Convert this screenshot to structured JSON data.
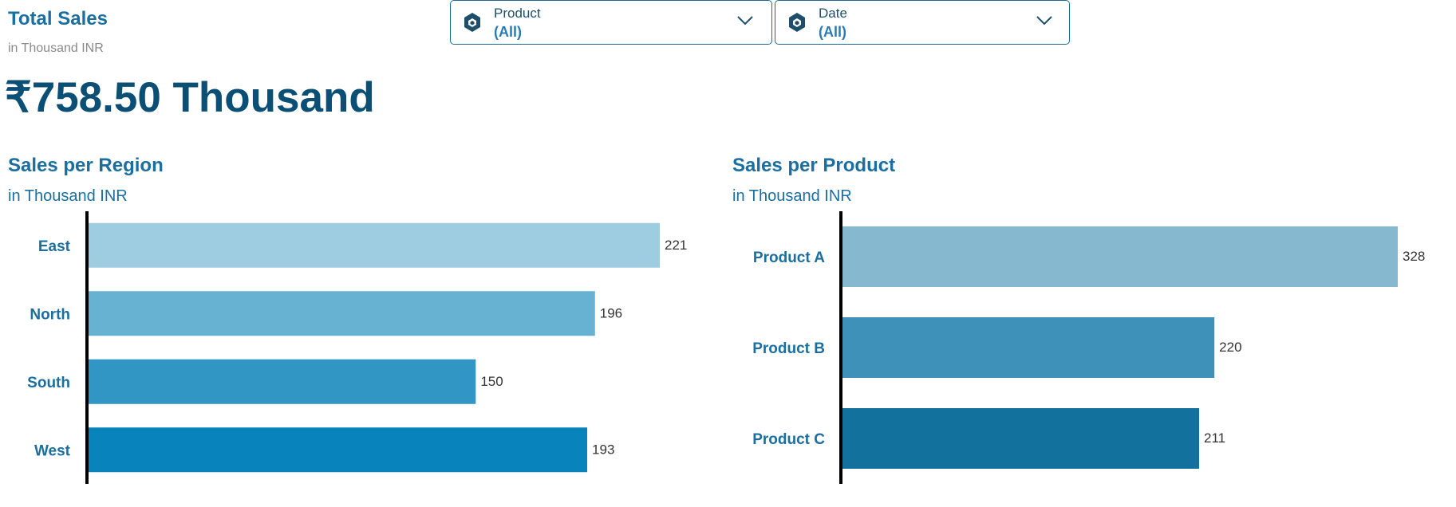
{
  "kpi": {
    "title": "Total Sales",
    "subtitle": "in Thousand INR",
    "value": "₹758.50 Thousand"
  },
  "filters": [
    {
      "label": "Product",
      "value": "(All)",
      "icon": "cube-icon"
    },
    {
      "label": "Date",
      "value": "(All)",
      "icon": "cube-icon"
    }
  ],
  "colors": {
    "title": "#1a6fa0",
    "kpi_value": "#0b4f75",
    "filter_border": "#1b6a96"
  },
  "chart_data": [
    {
      "type": "bar",
      "orientation": "horizontal",
      "title": "Sales per Region",
      "subtitle": "in Thousand INR",
      "categories": [
        "East",
        "North",
        "South",
        "West"
      ],
      "values": [
        221,
        196,
        150,
        193
      ],
      "colors": [
        "#9ecde2",
        "#67b1d2",
        "#3196c3",
        "#0883bb"
      ],
      "xlim": [
        0,
        221
      ]
    },
    {
      "type": "bar",
      "orientation": "horizontal",
      "title": "Sales per Product",
      "subtitle": "in Thousand INR",
      "categories": [
        "Product A",
        "Product B",
        "Product C"
      ],
      "values": [
        328,
        220,
        211
      ],
      "colors": [
        "#86b9d0",
        "#3e92b9",
        "#13719e"
      ],
      "xlim": [
        0,
        328
      ]
    }
  ]
}
